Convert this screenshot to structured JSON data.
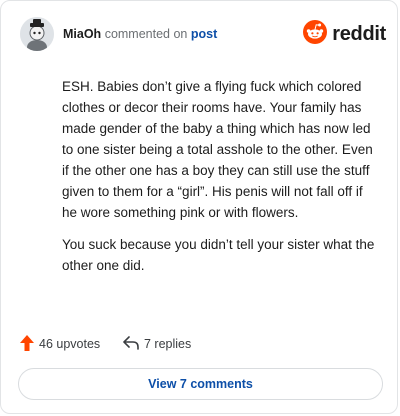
{
  "header": {
    "username": "MiaOh",
    "action": "commented on",
    "target": "post",
    "brand": "reddit"
  },
  "comment": {
    "paragraphs": [
      "ESH. Babies don’t give a flying fuck which colored clothes or decor their rooms have. Your family has made gender of the baby a thing which has now led to one sister being a total asshole to the other. Even if the other one has a boy they can still use the stuff given to them for a “girl”. His penis will not fall off if he wore something pink or with flowers.",
      "You suck because you didn’t tell your sister what the other one did."
    ]
  },
  "footer": {
    "upvotes": "46 upvotes",
    "replies": "7 replies",
    "view_comments": "View 7 comments"
  },
  "colors": {
    "brand_orange": "#ff4500",
    "link_blue": "#0d4fa8"
  },
  "icons": [
    "avatar",
    "reddit-logo-icon",
    "upvote-arrow-icon",
    "reply-arrow-icon"
  ]
}
